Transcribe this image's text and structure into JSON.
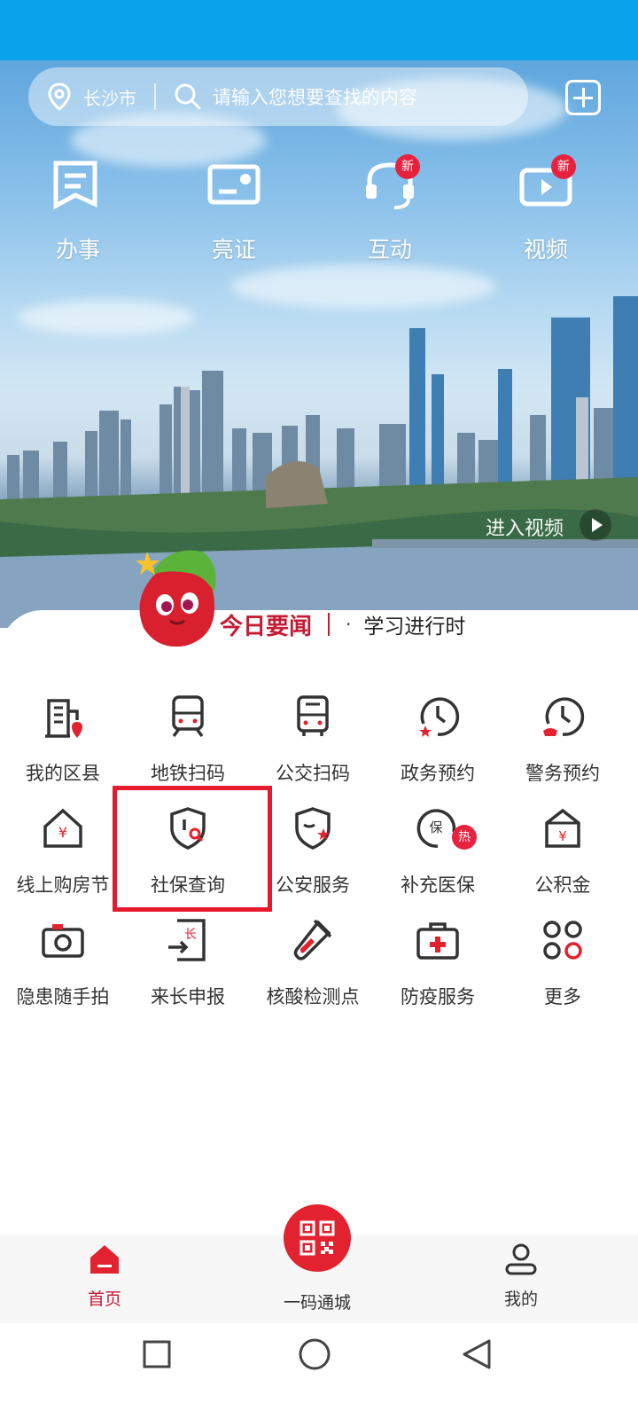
{
  "search": {
    "city": "长沙市",
    "placeholder": "请输入您想要查找的内容"
  },
  "quick_actions": [
    {
      "label": "办事",
      "icon": "document-check-icon",
      "badge": ""
    },
    {
      "label": "亮证",
      "icon": "id-card-icon",
      "badge": ""
    },
    {
      "label": "互动",
      "icon": "headset-icon",
      "badge": "新"
    },
    {
      "label": "视频",
      "icon": "video-icon",
      "badge": "新"
    }
  ],
  "hero": {
    "video_link": "进入视频"
  },
  "news": {
    "title": "今日要闻",
    "item": "学习进行时"
  },
  "services": [
    {
      "label": "我的区县",
      "icon": "building-location-icon",
      "badge": ""
    },
    {
      "label": "地铁扫码",
      "icon": "subway-icon",
      "badge": ""
    },
    {
      "label": "公交扫码",
      "icon": "bus-icon",
      "badge": ""
    },
    {
      "label": "政务预约",
      "icon": "clock-star-icon",
      "badge": ""
    },
    {
      "label": "警务预约",
      "icon": "clock-police-icon",
      "badge": ""
    },
    {
      "label": "线上购房节",
      "icon": "house-yuan-icon",
      "badge": ""
    },
    {
      "label": "社保查询",
      "icon": "shield-search-icon",
      "badge": ""
    },
    {
      "label": "公安服务",
      "icon": "shield-star-icon",
      "badge": ""
    },
    {
      "label": "补充医保",
      "icon": "insurance-icon",
      "badge": "热"
    },
    {
      "label": "公积金",
      "icon": "fund-box-icon",
      "badge": ""
    },
    {
      "label": "隐患随手拍",
      "icon": "camera-icon",
      "badge": ""
    },
    {
      "label": "来长申报",
      "icon": "declare-icon",
      "badge": ""
    },
    {
      "label": "核酸检测点",
      "icon": "test-tube-icon",
      "badge": ""
    },
    {
      "label": "防疫服务",
      "icon": "medical-kit-icon",
      "badge": ""
    },
    {
      "label": "更多",
      "icon": "more-grid-icon",
      "badge": ""
    }
  ],
  "tabs": {
    "home": "首页",
    "scan": "一码通城",
    "mine": "我的"
  },
  "colors": {
    "accent": "#e3222f",
    "status_bar": "#0aa2e8",
    "news_title": "#c41c35"
  }
}
